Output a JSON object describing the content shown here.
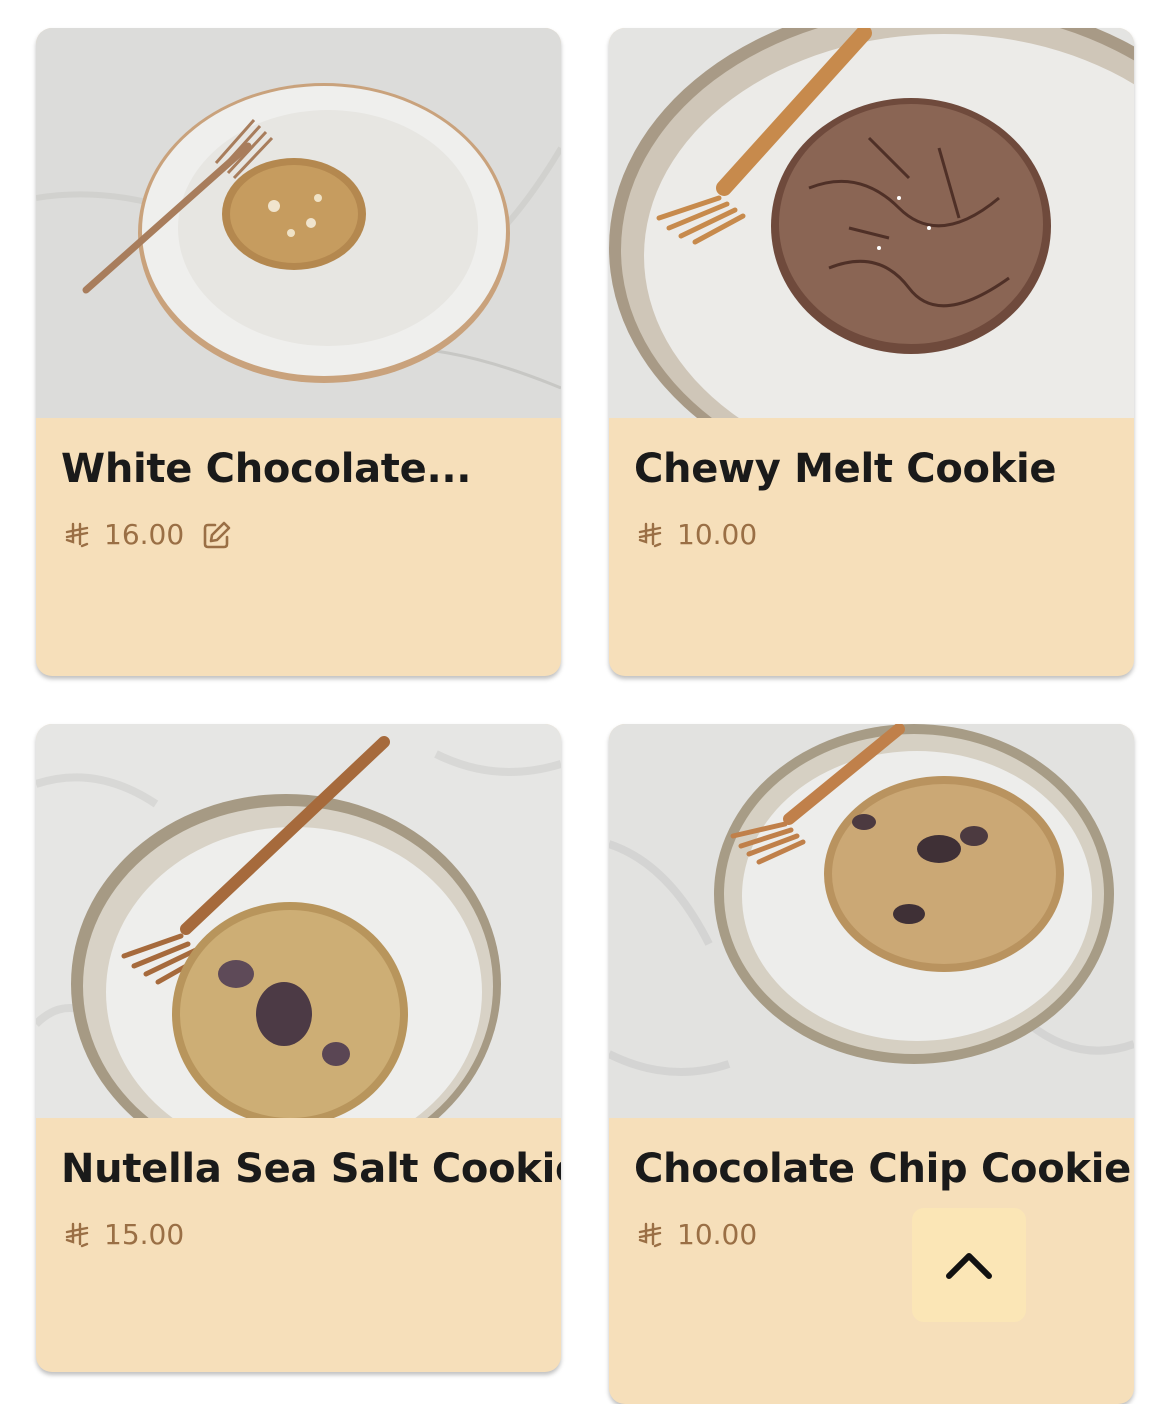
{
  "products": [
    {
      "name": "White Chocolate...",
      "price": "16.00",
      "currency_icon": "riyal-icon",
      "editable": true
    },
    {
      "name": "Chewy Melt Cookie",
      "price": "10.00",
      "currency_icon": "riyal-icon",
      "editable": false
    },
    {
      "name": "Nutella Sea Salt Cookie",
      "price": "15.00",
      "currency_icon": "riyal-icon",
      "editable": false
    },
    {
      "name": "Chocolate Chip Cookie",
      "price": "10.00",
      "currency_icon": "riyal-icon",
      "editable": false
    }
  ],
  "scroll_top_icon": "chevron-up-icon",
  "colors": {
    "card_background": "#f6dfba",
    "price_text": "#9a6f45",
    "title_text": "#1a1a1a",
    "scroll_button": "#fbe6b6"
  }
}
